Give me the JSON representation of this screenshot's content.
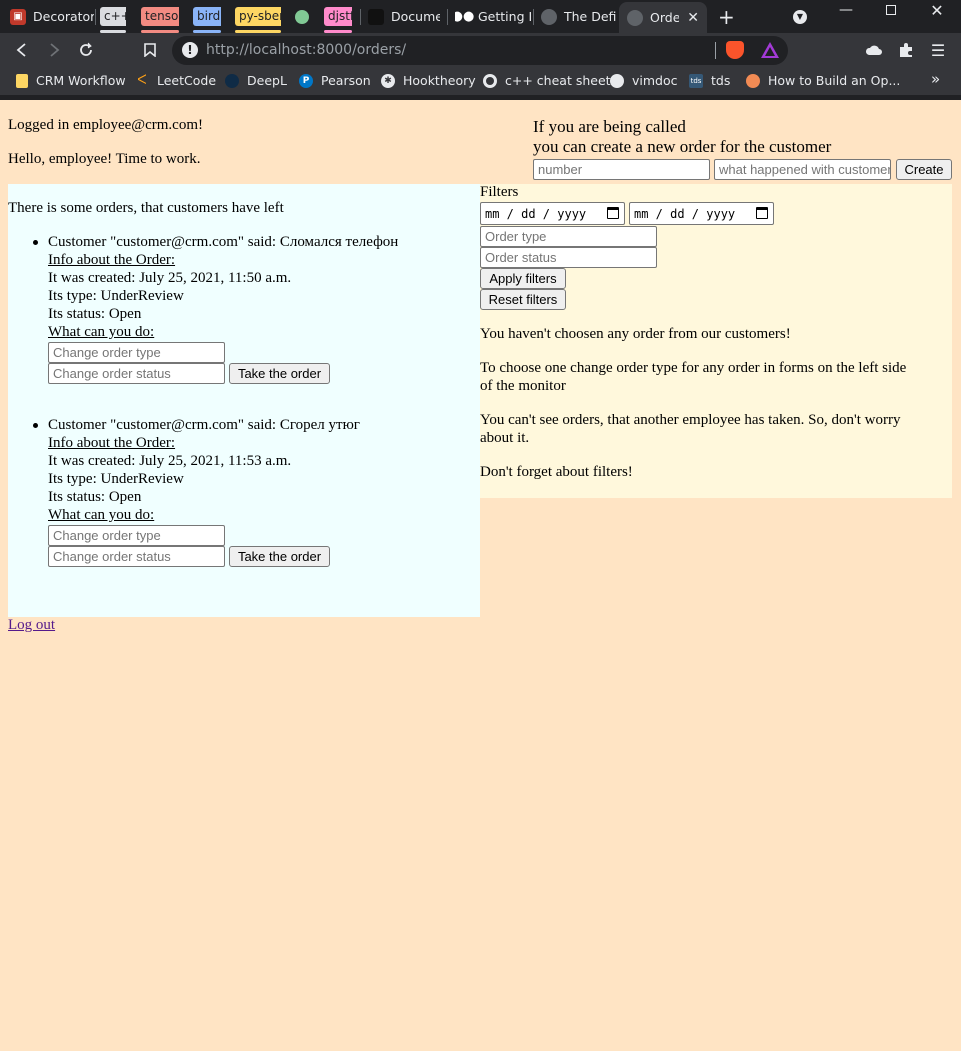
{
  "browser": {
    "tabs": [
      {
        "label": "Decorator"
      },
      {
        "label": "c++"
      },
      {
        "label": "tensor"
      },
      {
        "label": "bird"
      },
      {
        "label": "py-sber"
      },
      {
        "label": "djstf"
      },
      {
        "label": "Documen"
      },
      {
        "label": "Getting In"
      },
      {
        "label": "The Defin"
      },
      {
        "label": "Order"
      }
    ],
    "url_host": "http://localhost",
    "url_rest": ":8000/orders/",
    "bookmarks": [
      {
        "label": "CRM Workflow"
      },
      {
        "label": "LeetCode"
      },
      {
        "label": "DeepL"
      },
      {
        "label": "Pearson"
      },
      {
        "label": "Hooktheory"
      },
      {
        "label": "c++ cheat sheet"
      },
      {
        "label": "vimdoc"
      },
      {
        "label": "tds"
      },
      {
        "label": "How to Build an Op..."
      }
    ],
    "bookmark_icon_text": {
      "pearson": "P",
      "tds": "tds"
    },
    "more_bookmarks": "»"
  },
  "page": {
    "logged_in": "Logged in employee@crm.com!",
    "greeting": "Hello, employee! Time to work.",
    "call_line1": "If you are being called",
    "call_line2": "you can create a new order for the customer",
    "create_form": {
      "number_placeholder": "number",
      "description_placeholder": "what happened with customer",
      "create_label": "Create"
    },
    "orders_intro": "There is some orders, that customers have left",
    "orders": [
      {
        "said": "Customer \"customer@crm.com\" said: Сломался телефон",
        "info_label": "Info about the Order:",
        "created": "It was created: July 25, 2021, 11:50 a.m.",
        "type": "Its type: UnderReview",
        "status": "Its status: Open",
        "what_label": "What can you do:",
        "type_placeholder": "Change order type",
        "status_placeholder": "Change order status",
        "take_label": "Take the order"
      },
      {
        "said": "Customer \"customer@crm.com\" said: Сгорел утюг",
        "info_label": "Info about the Order:",
        "created": "It was created: July 25, 2021, 11:53 a.m.",
        "type": "Its type: UnderReview",
        "status": "Its status: Open",
        "what_label": "What can you do:",
        "type_placeholder": "Change order type",
        "status_placeholder": "Change order status",
        "take_label": "Take the order"
      }
    ],
    "filters": {
      "title": "Filters",
      "date_placeholder": "mm / dd / yyyy",
      "type_placeholder": "Order type",
      "status_placeholder": "Order status",
      "apply_label": "Apply filters",
      "reset_label": "Reset filters"
    },
    "info": {
      "p1": "You haven't choosen any order from our customers!",
      "p2a": "To choose one change order type for any order in forms on the left side",
      "p2b": "of the monitor",
      "p3a": "You can't see orders, that another employee has taken. So, don't worry",
      "p3b": "about it.",
      "p4": "Don't forget about filters!"
    },
    "logout": "Log out"
  },
  "colors": {
    "page_bg": "#ffe4c4",
    "orders_bg": "#f0ffff",
    "filters_bg": "#fff8dc"
  }
}
